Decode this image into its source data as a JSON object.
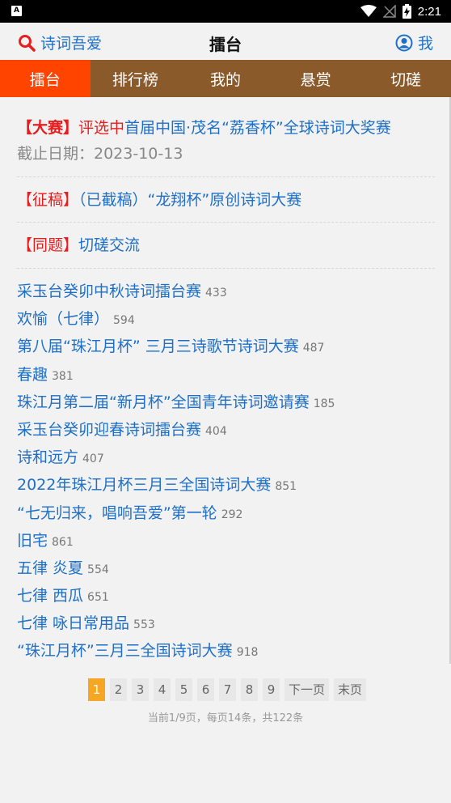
{
  "status_bar": {
    "app_glyph": "A",
    "time": "2:21",
    "icons": [
      "wifi-icon",
      "signal-off-icon",
      "battery-charging-icon"
    ]
  },
  "header": {
    "left_label": "诗词吾爱",
    "left_icon": "search-icon",
    "title": "擂台",
    "right_label": "我",
    "right_icon": "user-icon"
  },
  "tabs": [
    {
      "label": "擂台",
      "active": true
    },
    {
      "label": "排行榜",
      "active": false
    },
    {
      "label": "我的",
      "active": false
    },
    {
      "label": "悬赏",
      "active": false
    },
    {
      "label": "切磋",
      "active": false
    }
  ],
  "notices": {
    "contest": {
      "tag": "【大赛】",
      "status": "评选中",
      "title": "首届中国·茂名“荔香杯”全球诗词大奖赛",
      "deadline": "截止日期：2023-10-13"
    },
    "submission": {
      "tag": "【征稿】",
      "title": "（已截稿）“龙翔杯”原创诗词大赛"
    },
    "same_topic": {
      "tag": "【同题】",
      "title": "切磋交流"
    }
  },
  "list": [
    {
      "title": "采玉台癸卯中秋诗词擂台赛",
      "count": "433"
    },
    {
      "title": "欢愉（七律）",
      "count": "594"
    },
    {
      "title": "第八届“珠江月杯” 三月三诗歌节诗词大赛",
      "count": "487"
    },
    {
      "title": "春趣",
      "count": "381"
    },
    {
      "title": "珠江月第二届“新月杯”全国青年诗词邀请赛",
      "count": "185"
    },
    {
      "title": "采玉台癸卯迎春诗词擂台赛",
      "count": "404"
    },
    {
      "title": "诗和远方",
      "count": "407"
    },
    {
      "title": "2022年珠江月杯三月三全国诗词大赛",
      "count": "851"
    },
    {
      "title": "“七无归来，唱响吾爱”第一轮",
      "count": "292"
    },
    {
      "title": "旧宅",
      "count": "861"
    },
    {
      "title": "五律 炎夏",
      "count": "554"
    },
    {
      "title": "七律 西瓜",
      "count": "651"
    },
    {
      "title": "七律 咏日常用品",
      "count": "553"
    },
    {
      "title": "“珠江月杯”三月三全国诗词大赛",
      "count": "918"
    }
  ],
  "pagination": {
    "pages": [
      "1",
      "2",
      "3",
      "4",
      "5",
      "6",
      "7",
      "8",
      "9"
    ],
    "current": "1",
    "next_label": "下一页",
    "last_label": "末页",
    "info": "当前1/9页，每页14条，共122条"
  },
  "colors": {
    "accent": "#ff4400",
    "tab_bar": "#8b5a2b",
    "link": "#1e6fc8",
    "tag_red": "#e81e1e",
    "page_active": "#f5a623"
  }
}
